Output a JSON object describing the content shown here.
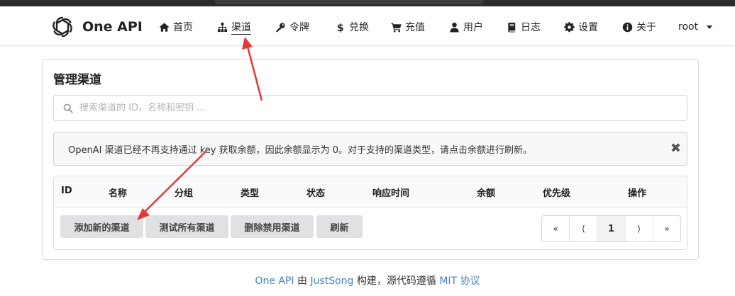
{
  "brand": {
    "name": "One API"
  },
  "nav": [
    {
      "key": "home",
      "label": "首页",
      "icon": "home-icon"
    },
    {
      "key": "channel",
      "label": "渠道",
      "icon": "sitemap-icon",
      "active": true
    },
    {
      "key": "token",
      "label": "令牌",
      "icon": "key-icon"
    },
    {
      "key": "redeem",
      "label": "兑换",
      "icon": "dollar-icon"
    },
    {
      "key": "topup",
      "label": "充值",
      "icon": "cart-icon"
    },
    {
      "key": "user",
      "label": "用户",
      "icon": "user-icon"
    },
    {
      "key": "log",
      "label": "日志",
      "icon": "book-icon"
    },
    {
      "key": "setting",
      "label": "设置",
      "icon": "gear-icon"
    },
    {
      "key": "about",
      "label": "关于",
      "icon": "info-icon"
    }
  ],
  "user": {
    "name": "root"
  },
  "page": {
    "title": "管理渠道"
  },
  "search": {
    "placeholder": "搜索渠道的 ID，名称和密钥 ..."
  },
  "alert": {
    "text": "OpenAI 渠道已经不再支持通过 key 获取余额，因此余额显示为 0。对于支持的渠道类型，请点击余额进行刷新。",
    "close": "✖"
  },
  "table": {
    "headers": [
      "ID",
      "名称",
      "分组",
      "类型",
      "状态",
      "响应时间",
      "余额",
      "优先级",
      "操作"
    ]
  },
  "buttons": {
    "add": "添加新的渠道",
    "test_all": "测试所有渠道",
    "delete_disabled": "删除禁用渠道",
    "refresh": "刷新"
  },
  "pagination": {
    "first": "«",
    "prev": "⟨",
    "current": "1",
    "next": "⟩",
    "last": "»"
  },
  "footer": {
    "app": "One API",
    "by": " 由 ",
    "author": "JustSong",
    "built": " 构建，源代码遵循 ",
    "license": "MIT 协议"
  },
  "colors": {
    "link": "#4183c4",
    "annotation_arrow": "#e53935",
    "button_bg": "#e0e1e2"
  }
}
